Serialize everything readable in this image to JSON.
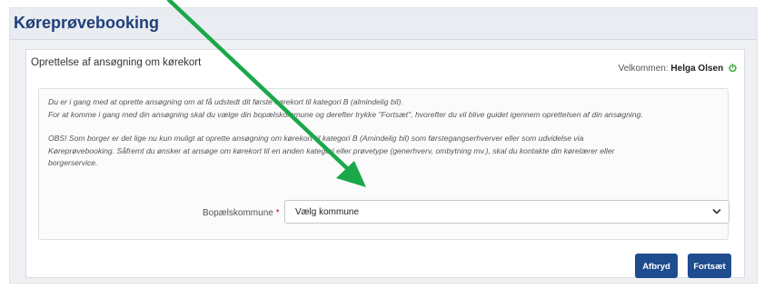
{
  "app": {
    "title": "Køreprøvebooking"
  },
  "page": {
    "subtitle": "Oprettelse af ansøgning om kørekort",
    "welcome_prefix": "Velkommen:",
    "user_name": "Helga Olsen"
  },
  "info": {
    "line1": "Du er i gang med at oprette ansøgning om at få udstedt dit første kørekort til kategori B (almindelig bil).",
    "line2": "For at komme i gang med din ansøgning skal du vælge din bopælskommune og derefter trykke \"Fortsæt\", hvorefter du vil blive guidet igennem oprettelsen af din ansøgning.",
    "line3": "OBS! Som borger er det lige nu kun muligt at oprette ansøgning om kørekort til kategori B (Amindelig bil) som førstegangserhverver eller som udvidelse via",
    "line4": "Køreprøvebooking. Såfremt du ønsker at ansøge om kørekort til en anden kategori eller prøvetype (generhverv, ombytning mv.), skal du kontakte din kørelærer eller",
    "line5": "borgerservice."
  },
  "form": {
    "municipality_label": "Bopælskommune",
    "required_mark": "*",
    "municipality_value": "Vælg kommune"
  },
  "buttons": {
    "cancel": "Afbryd",
    "continue": "Fortsæt"
  },
  "colors": {
    "brand": "#1e3f7a",
    "button": "#1e4c8f",
    "power_icon": "#3aa635",
    "annotation_arrow": "#1aa84a",
    "required": "#d0021b"
  },
  "icons": {
    "power": "power-icon",
    "dropdown": "chevron-down-icon",
    "annotation": "annotation-arrow-icon"
  }
}
